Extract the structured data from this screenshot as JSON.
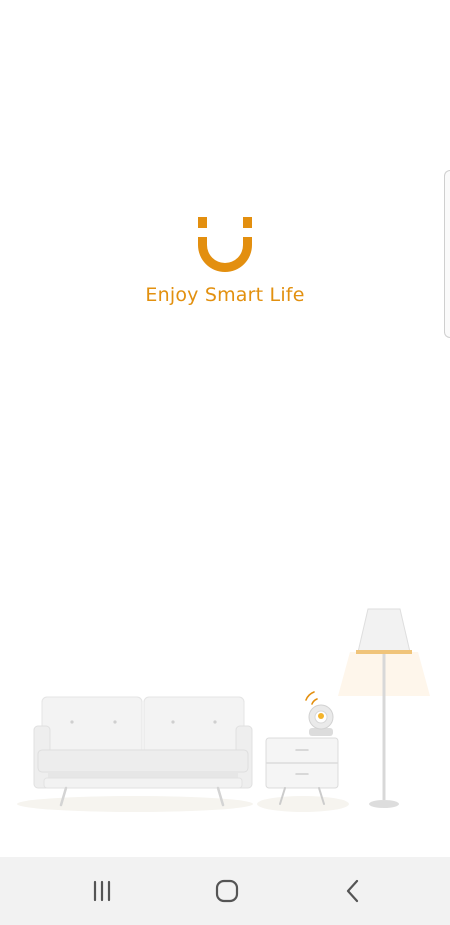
{
  "app": {
    "tagline": "Enjoy Smart Life",
    "brand_color": "#E38F0F"
  },
  "navbar": {
    "recents_icon": "recent-apps-icon",
    "home_icon": "home-icon",
    "back_icon": "back-icon"
  }
}
